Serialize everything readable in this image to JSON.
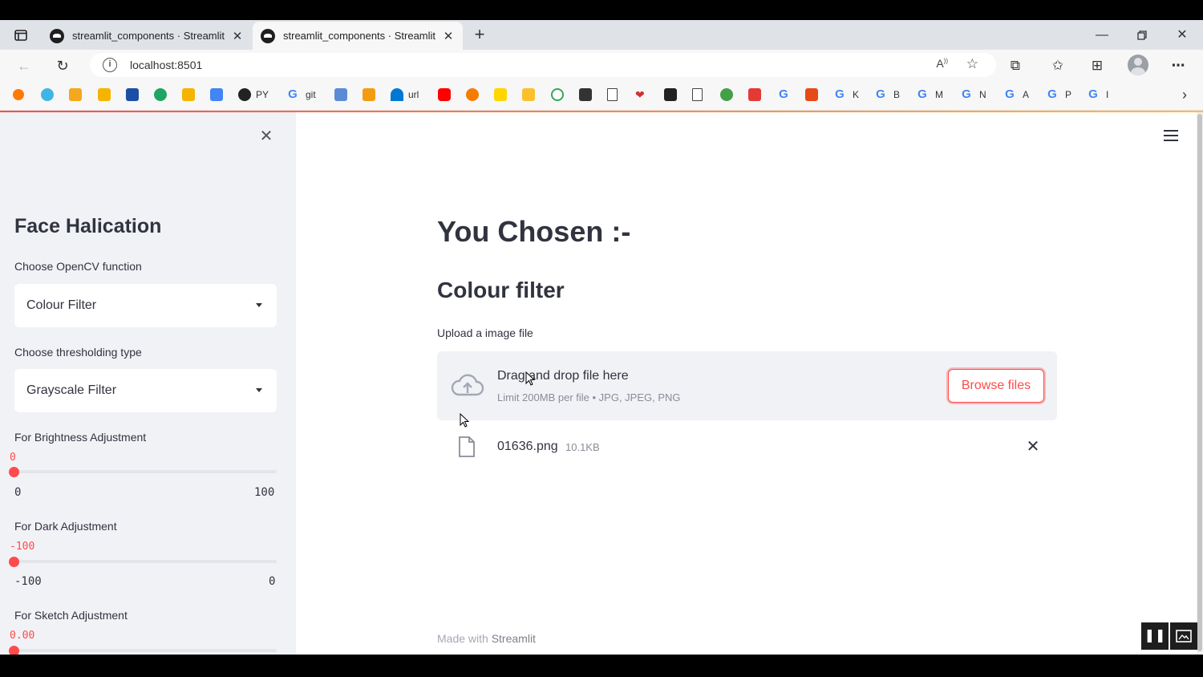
{
  "browser": {
    "tabs": [
      {
        "title": "streamlit_components · Streamlit",
        "active": false
      },
      {
        "title": "streamlit_components · Streamlit",
        "active": true
      }
    ],
    "url": "localhost:8501",
    "bookmarks": [
      {
        "label": "PY"
      },
      {
        "label": "git"
      },
      {
        "label": "url"
      },
      {
        "label": "K"
      },
      {
        "label": "B"
      },
      {
        "label": "M"
      },
      {
        "label": "N"
      },
      {
        "label": "A"
      },
      {
        "label": "P"
      },
      {
        "label": "I"
      }
    ]
  },
  "sidebar": {
    "title": "Face Halication",
    "function_label": "Choose OpenCV function",
    "function_value": "Colour Filter",
    "threshold_label": "Choose thresholding type",
    "threshold_value": "Grayscale Filter",
    "sliders": [
      {
        "label": "For Brightness Adjustment",
        "value": "0",
        "min": "0",
        "max": "100",
        "fraction": 0
      },
      {
        "label": "For Dark Adjustment",
        "value": "-100",
        "min": "-100",
        "max": "0",
        "fraction": 0
      },
      {
        "label": "For Sketch Adjustment",
        "value": "0.00",
        "fraction": 0
      }
    ]
  },
  "main": {
    "heading": "You Chosen :-",
    "subheading": "Colour filter",
    "uploader": {
      "label": "Upload a image file",
      "drop_text": "Drag and drop file here",
      "limit_text": "Limit 200MB per file • JPG, JPEG, PNG",
      "browse_label": "Browse files"
    },
    "file": {
      "name": "01636.png",
      "size": "10.1KB"
    },
    "footer_prefix": "Made with",
    "footer_brand": "Streamlit"
  },
  "colors": {
    "accent": "#ff4b4b",
    "sidebar_bg": "#f0f2f6",
    "text": "#31333f"
  }
}
